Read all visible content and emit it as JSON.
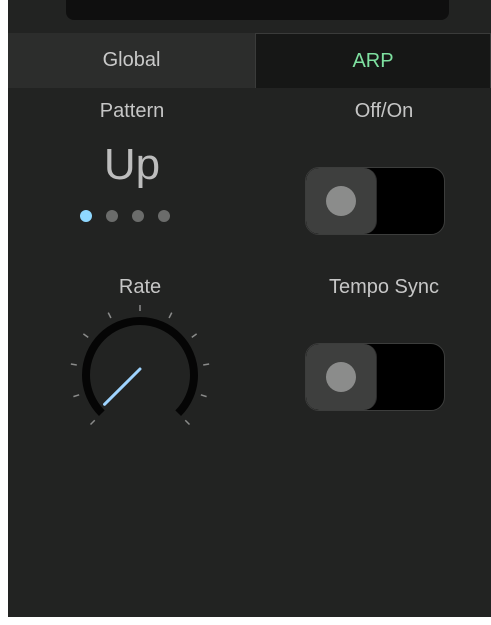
{
  "tabs": {
    "global": "Global",
    "arp": "ARP"
  },
  "pattern": {
    "label": "Pattern",
    "value": "Up",
    "dot_count": 4,
    "active_dot": 0
  },
  "arp_switch": {
    "label": "Off/On",
    "state": "off"
  },
  "rate": {
    "label": "Rate",
    "level": 0.02
  },
  "tempo_sync": {
    "label": "Tempo Sync",
    "state": "off"
  },
  "colors": {
    "background": "#222322",
    "active_tab_text": "#7ee0a0",
    "accent": "#8fd8ff"
  }
}
